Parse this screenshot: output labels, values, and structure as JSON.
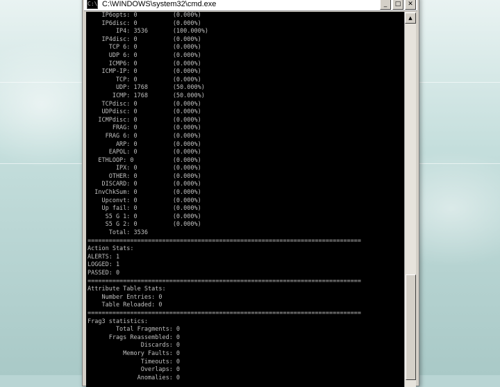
{
  "window": {
    "title": "C:\\WINDOWS\\system32\\cmd.exe",
    "icon_text": "C:\\",
    "buttons": {
      "minimize": "_",
      "maximize": "□",
      "close": "✕"
    }
  },
  "console": {
    "lines": [
      "    IP6opts: 0          (0.000%)",
      "    IP6disc: 0          (0.000%)",
      "        IP4: 3536       (100.000%)",
      "    IP4disc: 0          (0.000%)",
      "      TCP 6: 0          (0.000%)",
      "      UDP 6: 0          (0.000%)",
      "      ICMP6: 0          (0.000%)",
      "    ICMP-IP: 0          (0.000%)",
      "        TCP: 0          (0.000%)",
      "        UDP: 1768       (50.000%)",
      "       ICMP: 1768       (50.000%)",
      "    TCPdisc: 0          (0.000%)",
      "    UDPdisc: 0          (0.000%)",
      "   ICMPdisc: 0          (0.000%)",
      "       FRAG: 0          (0.000%)",
      "     FRAG 6: 0          (0.000%)",
      "        ARP: 0          (0.000%)",
      "      EAPOL: 0          (0.000%)",
      "   ETHLOOP: 0           (0.000%)",
      "        IPX: 0          (0.000%)",
      "      OTHER: 0          (0.000%)",
      "    DISCARD: 0          (0.000%)",
      "  InvChkSum: 0          (0.000%)",
      "    Upconvt: 0          (0.000%)",
      "    Up fail: 0          (0.000%)",
      "     S5 G 1: 0          (0.000%)",
      "     S5 G 2: 0          (0.000%)",
      "      Total: 3536",
      "=============================================================================",
      "Action Stats:",
      "ALERTS: 1",
      "LOGGED: 1",
      "PASSED: 0",
      "=============================================================================",
      "Attribute Table Stats:",
      "    Number Entries: 0",
      "    Table Reloaded: 0",
      "=============================================================================",
      "Frag3 statistics:",
      "        Total Fragments: 0",
      "      Frags Reassembled: 0",
      "               Discards: 0",
      "          Memory Faults: 0",
      "               Timeouts: 0",
      "               Overlaps: 0",
      "              Anomalies: 0"
    ]
  }
}
